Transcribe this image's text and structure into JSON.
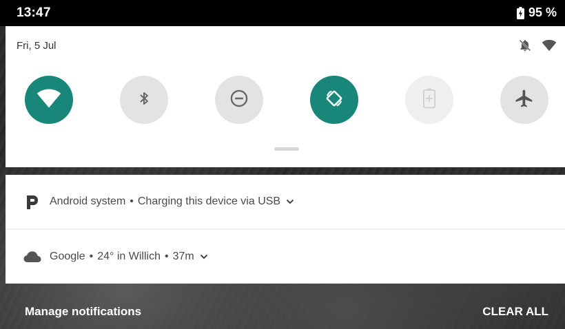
{
  "status_bar": {
    "time": "13:47",
    "battery_percent": "95 %",
    "battery_icon": "battery-charging-icon"
  },
  "quick_settings": {
    "date": "Fri, 5 Jul",
    "header_icons": [
      "notifications-off-icon",
      "wifi-icon"
    ],
    "accent_color": "#18877a",
    "tiles": [
      {
        "icon": "wifi-icon",
        "state": "on"
      },
      {
        "icon": "bluetooth-icon",
        "state": "off"
      },
      {
        "icon": "do-not-disturb-icon",
        "state": "off"
      },
      {
        "icon": "auto-rotate-icon",
        "state": "on"
      },
      {
        "icon": "battery-saver-icon",
        "state": "unavailable"
      },
      {
        "icon": "airplane-mode-icon",
        "state": "off"
      }
    ]
  },
  "notifications": [
    {
      "icon": "android-system-icon",
      "app": "Android system",
      "separator": "•",
      "text": "Charging this device via USB"
    },
    {
      "icon": "cloud-icon",
      "app": "Google",
      "separator": "•",
      "text": "24° in Willich",
      "time": "37m"
    }
  ],
  "footer": {
    "manage_label": "Manage notifications",
    "clear_label": "CLEAR ALL"
  }
}
